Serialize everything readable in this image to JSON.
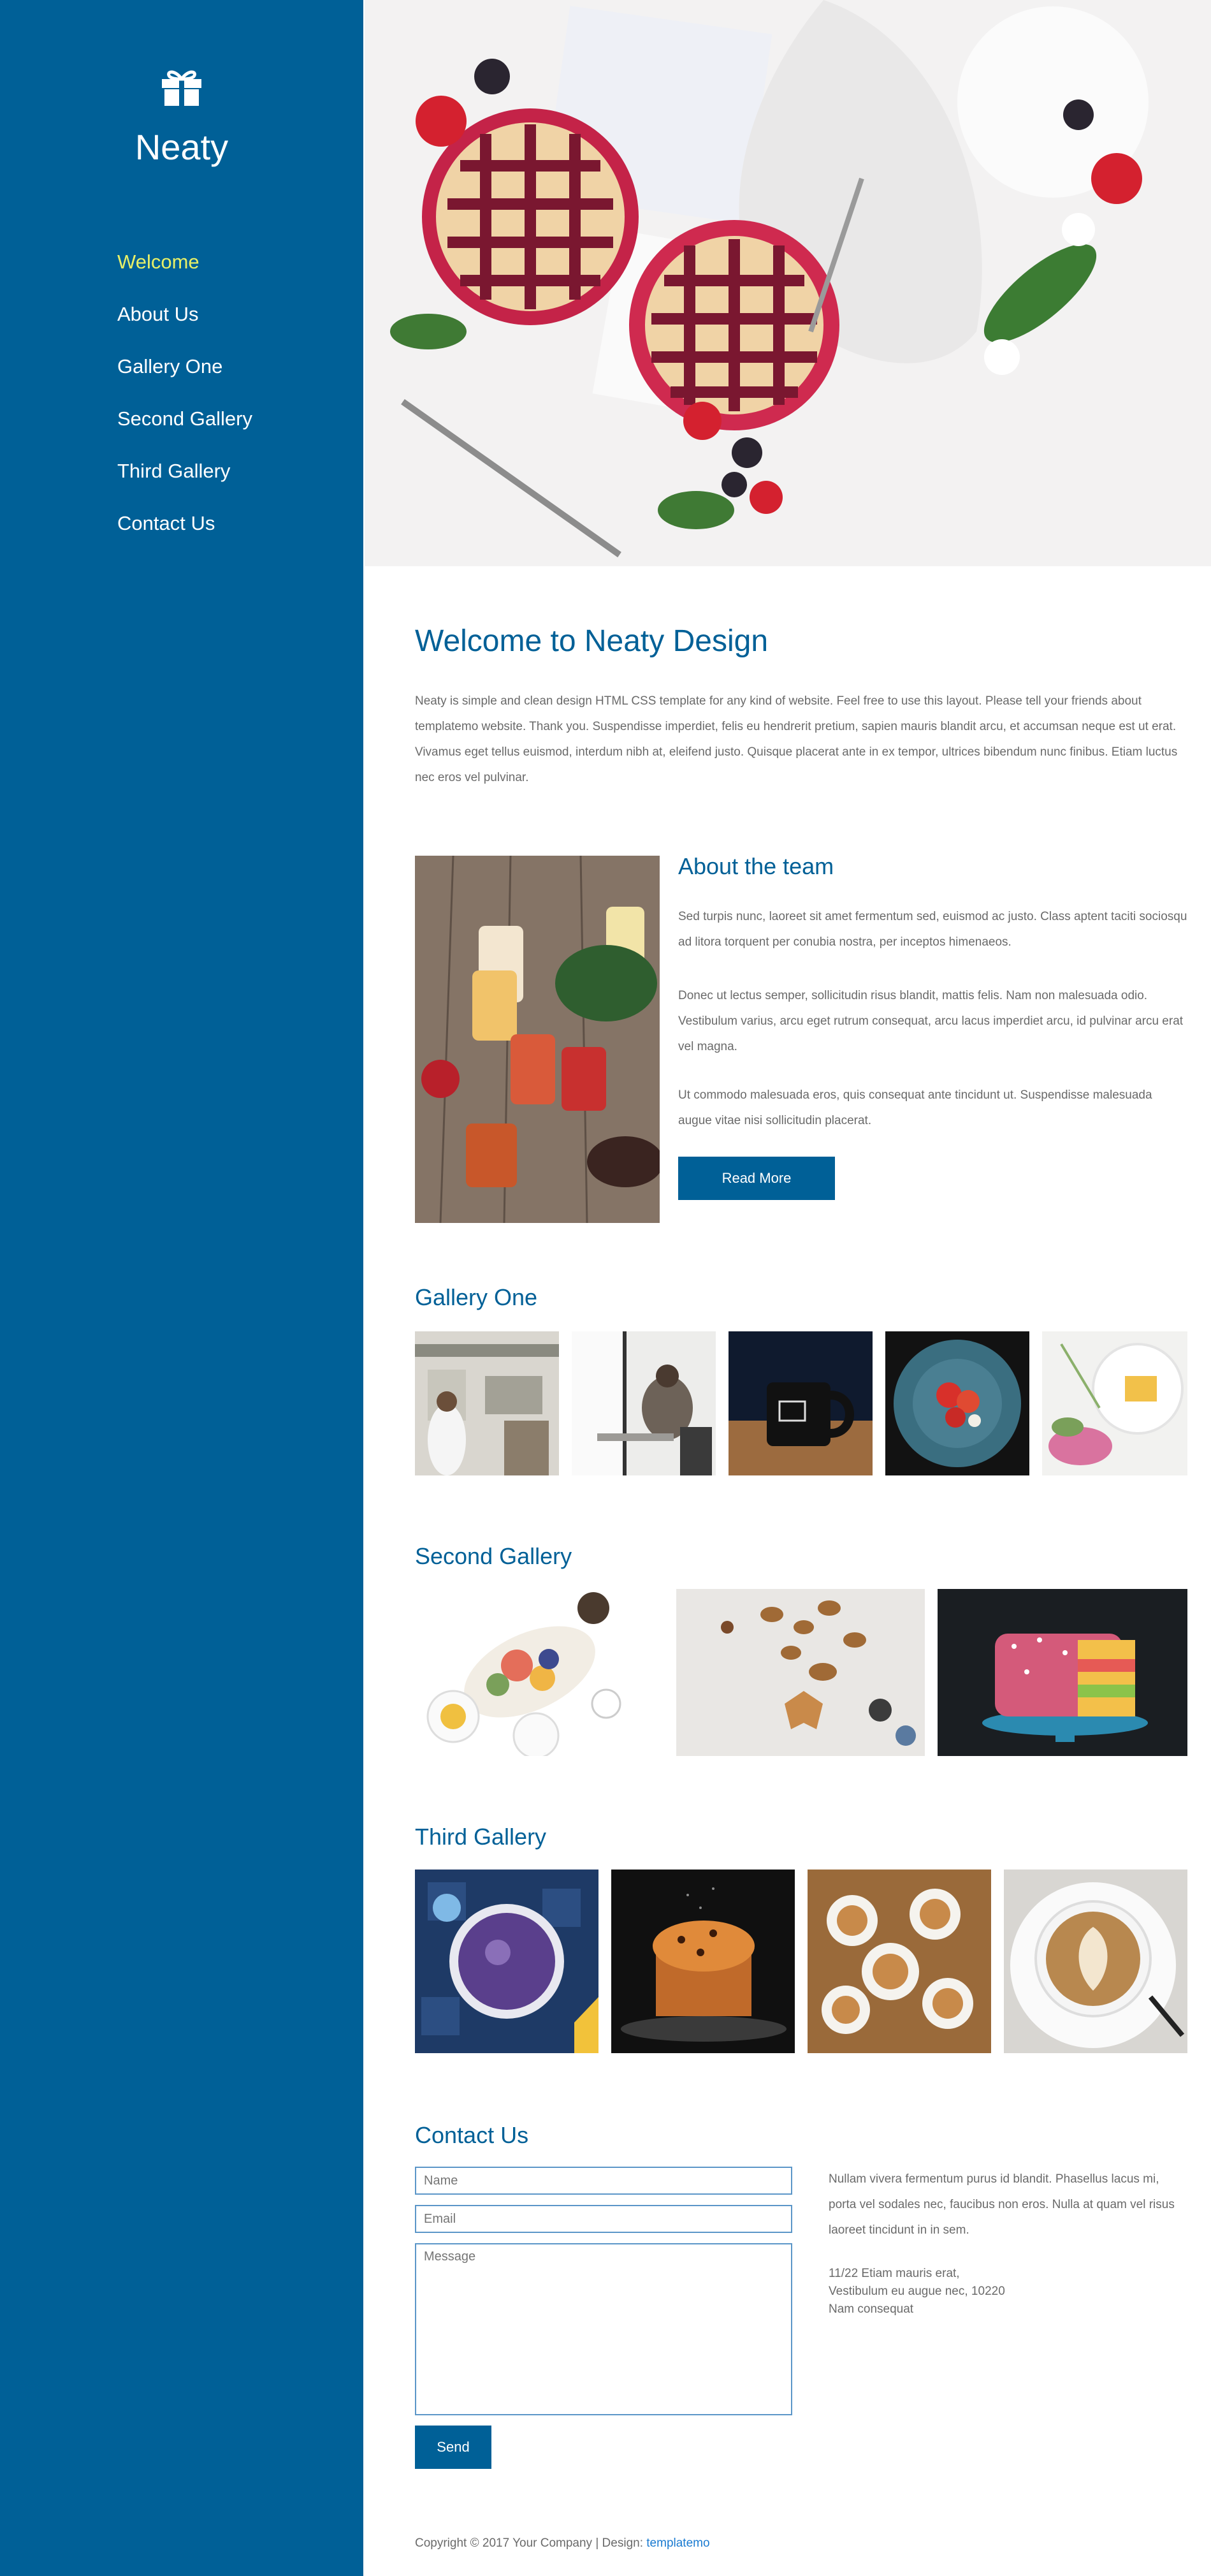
{
  "sidebar": {
    "logo_icon": "gift-icon",
    "brand": "Neaty",
    "nav": [
      {
        "label": "Welcome",
        "active": true
      },
      {
        "label": "About Us",
        "active": false
      },
      {
        "label": "Gallery One",
        "active": false
      },
      {
        "label": "Second Gallery",
        "active": false
      },
      {
        "label": "Third Gallery",
        "active": false
      },
      {
        "label": "Contact Us",
        "active": false
      }
    ]
  },
  "welcome": {
    "title": "Welcome to Neaty Design",
    "text": "Neaty is simple and clean design HTML CSS template for any kind of website. Feel free to use this layout. Please tell your friends about templatemo website. Thank you. Suspendisse imperdiet, felis eu hendrerit pretium, sapien mauris blandit arcu, et accumsan neque est ut erat. Vivamus eget tellus euismod, interdum nibh at, eleifend justo. Quisque placerat ante in ex tempor, ultrices bibendum nunc finibus. Etiam luctus nec eros vel pulvinar."
  },
  "about": {
    "title": "About the team",
    "p1": "Sed turpis nunc, laoreet sit amet fermentum sed, euismod ac justo. Class aptent taciti sociosqu ad litora torquent per conubia nostra, per inceptos himenaeos.",
    "p2": "Donec ut lectus semper, sollicitudin risus blandit, mattis felis. Nam non malesuada odio. Vestibulum varius, arcu eget rutrum consequat, arcu lacus imperdiet arcu, id pulvinar arcu erat vel magna.",
    "p3": "Ut commodo malesuada eros, quis consequat ante tincidunt ut. Suspendisse malesuada augue vitae nisi sollicitudin placerat.",
    "button": "Read More"
  },
  "gallery_one": {
    "title": "Gallery One"
  },
  "gallery_two": {
    "title": "Second Gallery"
  },
  "gallery_three": {
    "title": "Third Gallery"
  },
  "contact": {
    "title": "Contact Us",
    "name_placeholder": "Name",
    "email_placeholder": "Email",
    "message_placeholder": "Message",
    "send": "Send",
    "text": "Nullam vivera fermentum purus id blandit. Phasellus lacus mi, porta vel sodales nec, faucibus non eros. Nulla at quam vel risus laoreet tincidunt in in sem.",
    "address_line1": "11/22 Etiam mauris erat,",
    "address_line2": "Vestibulum eu augue nec, 10220",
    "address_line3": "Nam consequat"
  },
  "footer": {
    "copyright": "Copyright © 2017 Your Company | Design: ",
    "link": "templatemo"
  },
  "colors": {
    "primary": "#006097",
    "active_nav": "#e8f067",
    "text": "#6a6a6a"
  }
}
